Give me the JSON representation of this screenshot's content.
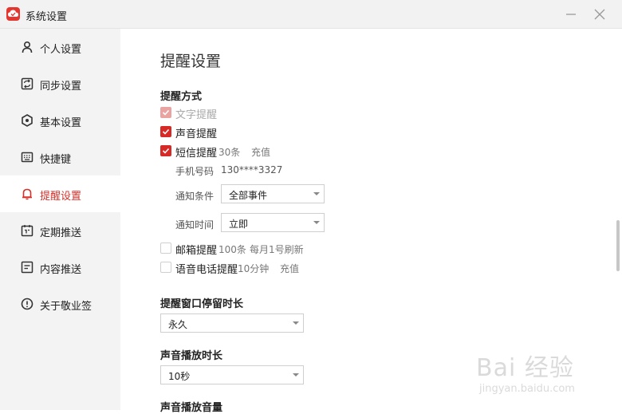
{
  "window": {
    "title": "系统设置"
  },
  "sidebar": {
    "items": [
      {
        "label": "个人设置",
        "icon": "user-icon",
        "active": false
      },
      {
        "label": "同步设置",
        "icon": "sync-icon",
        "active": false
      },
      {
        "label": "基本设置",
        "icon": "settings-icon",
        "active": false
      },
      {
        "label": "快捷键",
        "icon": "keyboard-icon",
        "active": false
      },
      {
        "label": "提醒设置",
        "icon": "bell-icon",
        "active": true
      },
      {
        "label": "定期推送",
        "icon": "calendar-icon",
        "active": false
      },
      {
        "label": "内容推送",
        "icon": "content-icon",
        "active": false
      },
      {
        "label": "关于敬业签",
        "icon": "info-icon",
        "active": false
      }
    ]
  },
  "page": {
    "title": "提醒设置"
  },
  "reminder_method": {
    "title": "提醒方式",
    "text_reminder": {
      "label": "文字提醒",
      "checked": true,
      "disabled": true
    },
    "sound_reminder": {
      "label": "声音提醒",
      "checked": true
    },
    "sms_reminder": {
      "label": "短信提醒",
      "checked": true,
      "quota": "30条",
      "recharge": "充值"
    },
    "phone": {
      "label": "手机号码",
      "value": "130****3327"
    },
    "notify_condition": {
      "label": "通知条件",
      "value": "全部事件"
    },
    "notify_time": {
      "label": "通知时间",
      "value": "立即"
    },
    "email_reminder": {
      "label": "邮箱提醒",
      "checked": false,
      "quota": "100条",
      "refresh": "每月1号刷新"
    },
    "voice_reminder": {
      "label": "语音电话提醒",
      "checked": false,
      "quota": "10分钟",
      "recharge": "充值"
    }
  },
  "popup_duration": {
    "title": "提醒窗口停留时长",
    "value": "永久"
  },
  "sound_duration": {
    "title": "声音播放时长",
    "value": "10秒"
  },
  "sound_volume": {
    "title": "声音播放音量"
  },
  "watermark": {
    "main": "Bai 经验",
    "sub": "jingyan.baidu.com"
  },
  "colors": {
    "accent": "#d52a25",
    "sidebar_bg": "#f3f3f3",
    "titlebar_bg": "#f2f2f2"
  }
}
